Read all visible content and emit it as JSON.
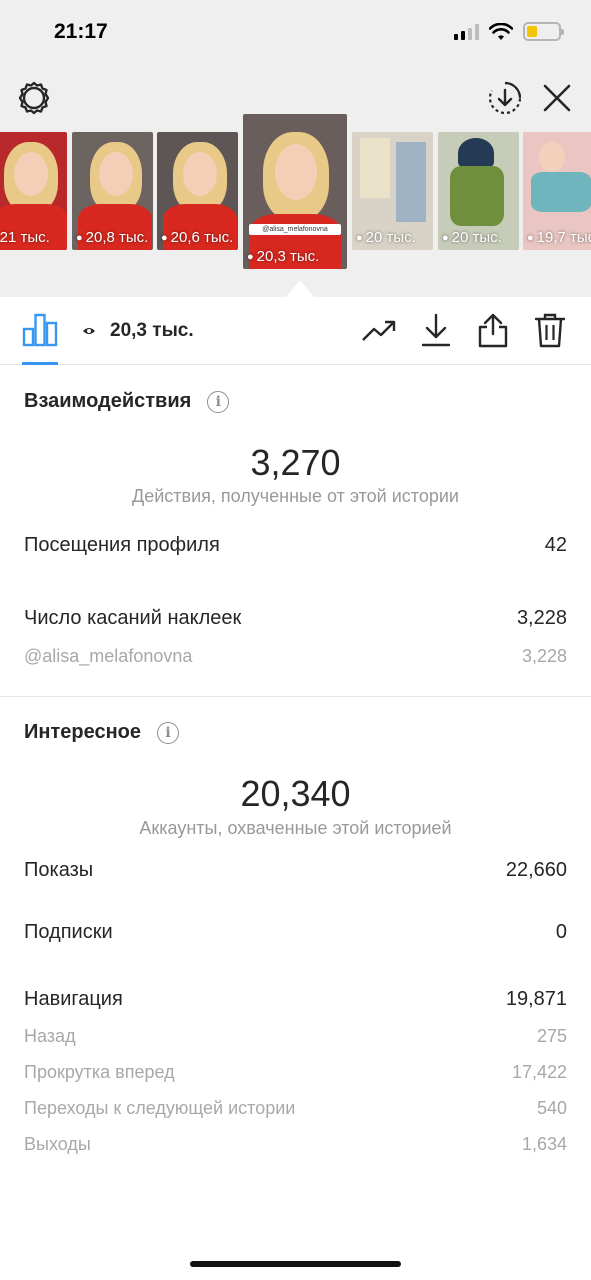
{
  "status_bar": {
    "time": "21:17",
    "battery_level": 0.3,
    "battery_color": "#f5c400"
  },
  "header": {
    "icons": [
      "gear-icon",
      "download-circle-icon",
      "close-icon"
    ]
  },
  "stories": [
    {
      "views": "21 тыс."
    },
    {
      "views": "20,8 тыс."
    },
    {
      "views": "20,6 тыс."
    },
    {
      "views": "20,3 тыс.",
      "active": true,
      "tag": "@alisa_melafonovna"
    },
    {
      "views": "20 тыс."
    },
    {
      "views": "20 тыс."
    },
    {
      "views": "19,7 тыс."
    }
  ],
  "story_tags": {
    "thumb3": "@alisa_melafonovna"
  },
  "toolbar": {
    "views_count": "20,3 тыс.",
    "icons": [
      "bar-chart-icon",
      "eye-icon",
      "trending-icon",
      "download-icon",
      "share-icon",
      "trash-icon"
    ],
    "accent_color": "#3897f0"
  },
  "interactions": {
    "title": "Взаимодействия",
    "total": "3,270",
    "total_caption": "Действия, полученные от этой истории",
    "rows": [
      {
        "label": "Посещения профиля",
        "value": "42"
      },
      {
        "label": "Число касаний наклеек",
        "value": "3,228"
      }
    ],
    "sub_rows": [
      {
        "label": "@alisa_melafonovna",
        "value": "3,228"
      }
    ]
  },
  "discovery": {
    "title": "Интересное",
    "total": "20,340",
    "total_caption": "Аккаунты, охваченные этой историей",
    "rows": [
      {
        "label": "Показы",
        "value": "22,660"
      },
      {
        "label": "Подписки",
        "value": "0"
      },
      {
        "label": "Навигация",
        "value": "19,871"
      }
    ],
    "nav_rows": [
      {
        "label": "Назад",
        "value": "275"
      },
      {
        "label": "Прокрутка вперед",
        "value": "17,422"
      },
      {
        "label": "Переходы к следующей истории",
        "value": "540"
      },
      {
        "label": "Выходы",
        "value": "1,634"
      }
    ]
  }
}
